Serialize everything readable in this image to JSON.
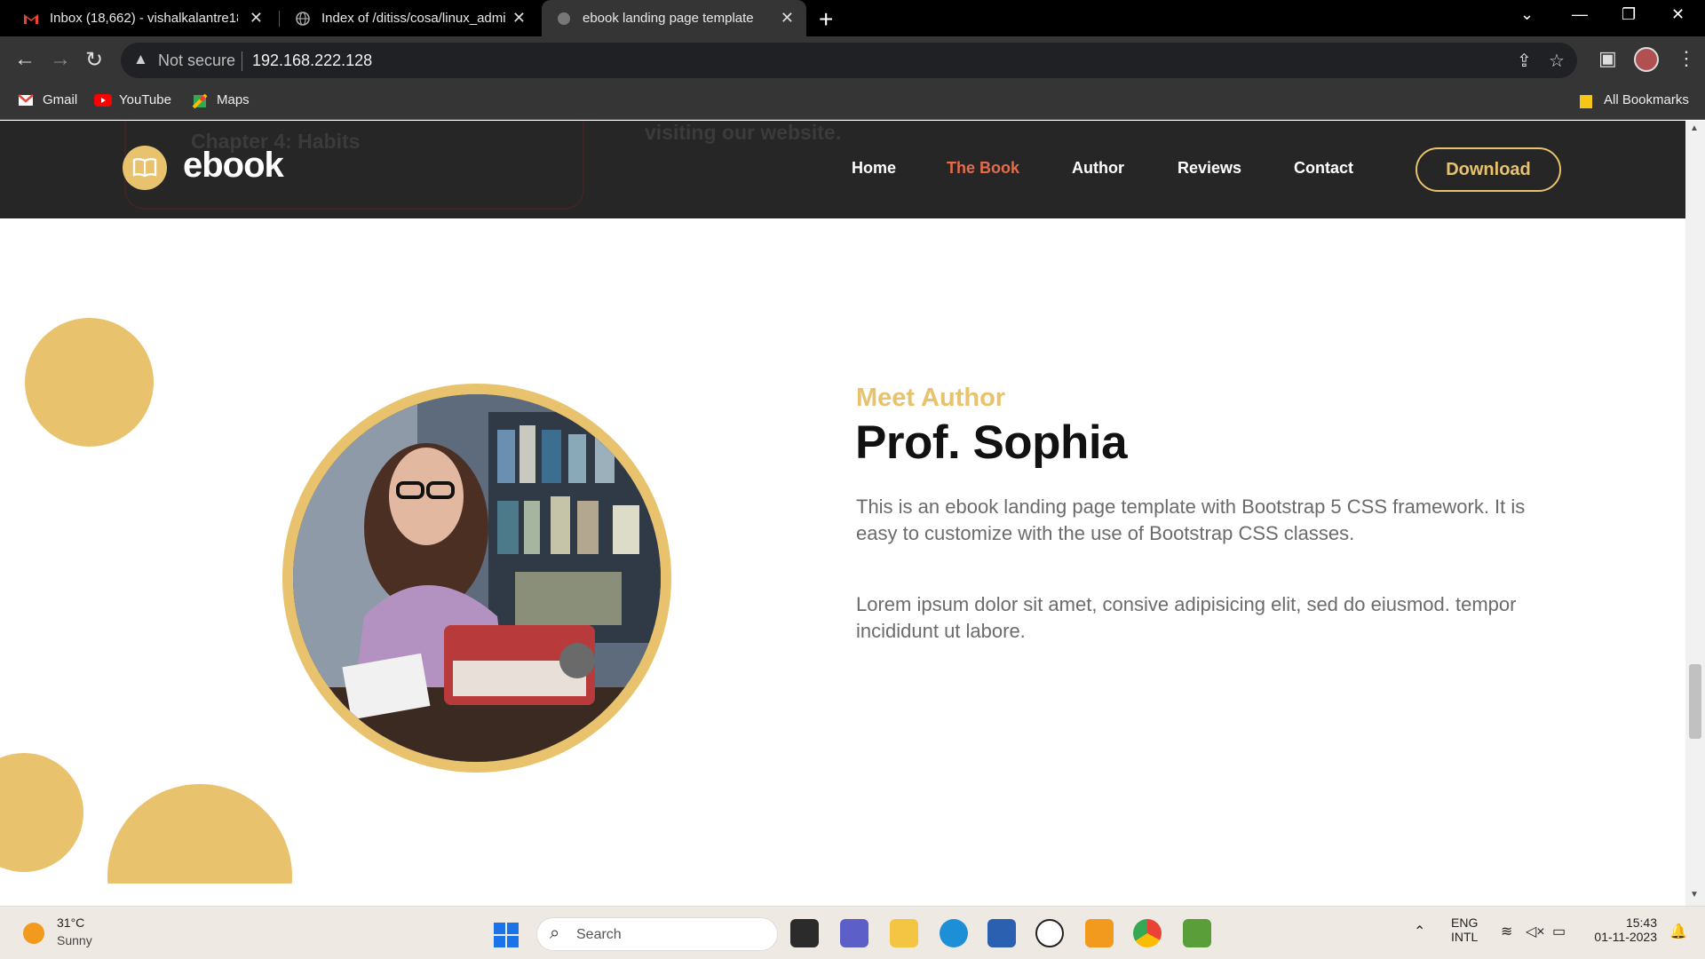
{
  "browser": {
    "tabs": [
      {
        "title": "Inbox (18,662) - vishalkalantre18",
        "icon": "gmail-icon"
      },
      {
        "title": "Index of /ditiss/cosa/linux_admi",
        "icon": "globe-icon"
      },
      {
        "title": "ebook landing page template",
        "icon": "globe-icon",
        "active": true
      }
    ],
    "security_label": "Not secure",
    "url": "192.168.222.128",
    "bookmarks": [
      {
        "label": "Gmail",
        "icon": "gmail-icon"
      },
      {
        "label": "YouTube",
        "icon": "youtube-icon"
      },
      {
        "label": "Maps",
        "icon": "maps-icon"
      }
    ],
    "all_bookmarks": "All Bookmarks"
  },
  "page": {
    "behind_text": "Chapter 4: Habits",
    "behind_text2": "visiting our website.",
    "logo_text": "ebook",
    "nav": [
      "Home",
      "The Book",
      "Author",
      "Reviews",
      "Contact"
    ],
    "active_nav": "The Book",
    "download_label": "Download",
    "eyebrow": "Meet Author",
    "author_name": "Prof. Sophia",
    "paragraph1": "This is an ebook landing page template with Bootstrap 5 CSS framework. It is easy to customize with the use of Bootstrap CSS classes.",
    "paragraph2": "Lorem ipsum dolor sit amet, consive adipisicing elit, sed do eiusmod. tempor incididunt ut labore.",
    "colors": {
      "accent": "#e8c26c",
      "active_nav": "#e46c4a",
      "navbar": "#262626"
    }
  },
  "taskbar": {
    "temperature": "31°C",
    "weather": "Sunny",
    "search_placeholder": "Search",
    "language1": "ENG",
    "language2": "INTL",
    "time": "15:43",
    "date": "01-11-2023"
  }
}
